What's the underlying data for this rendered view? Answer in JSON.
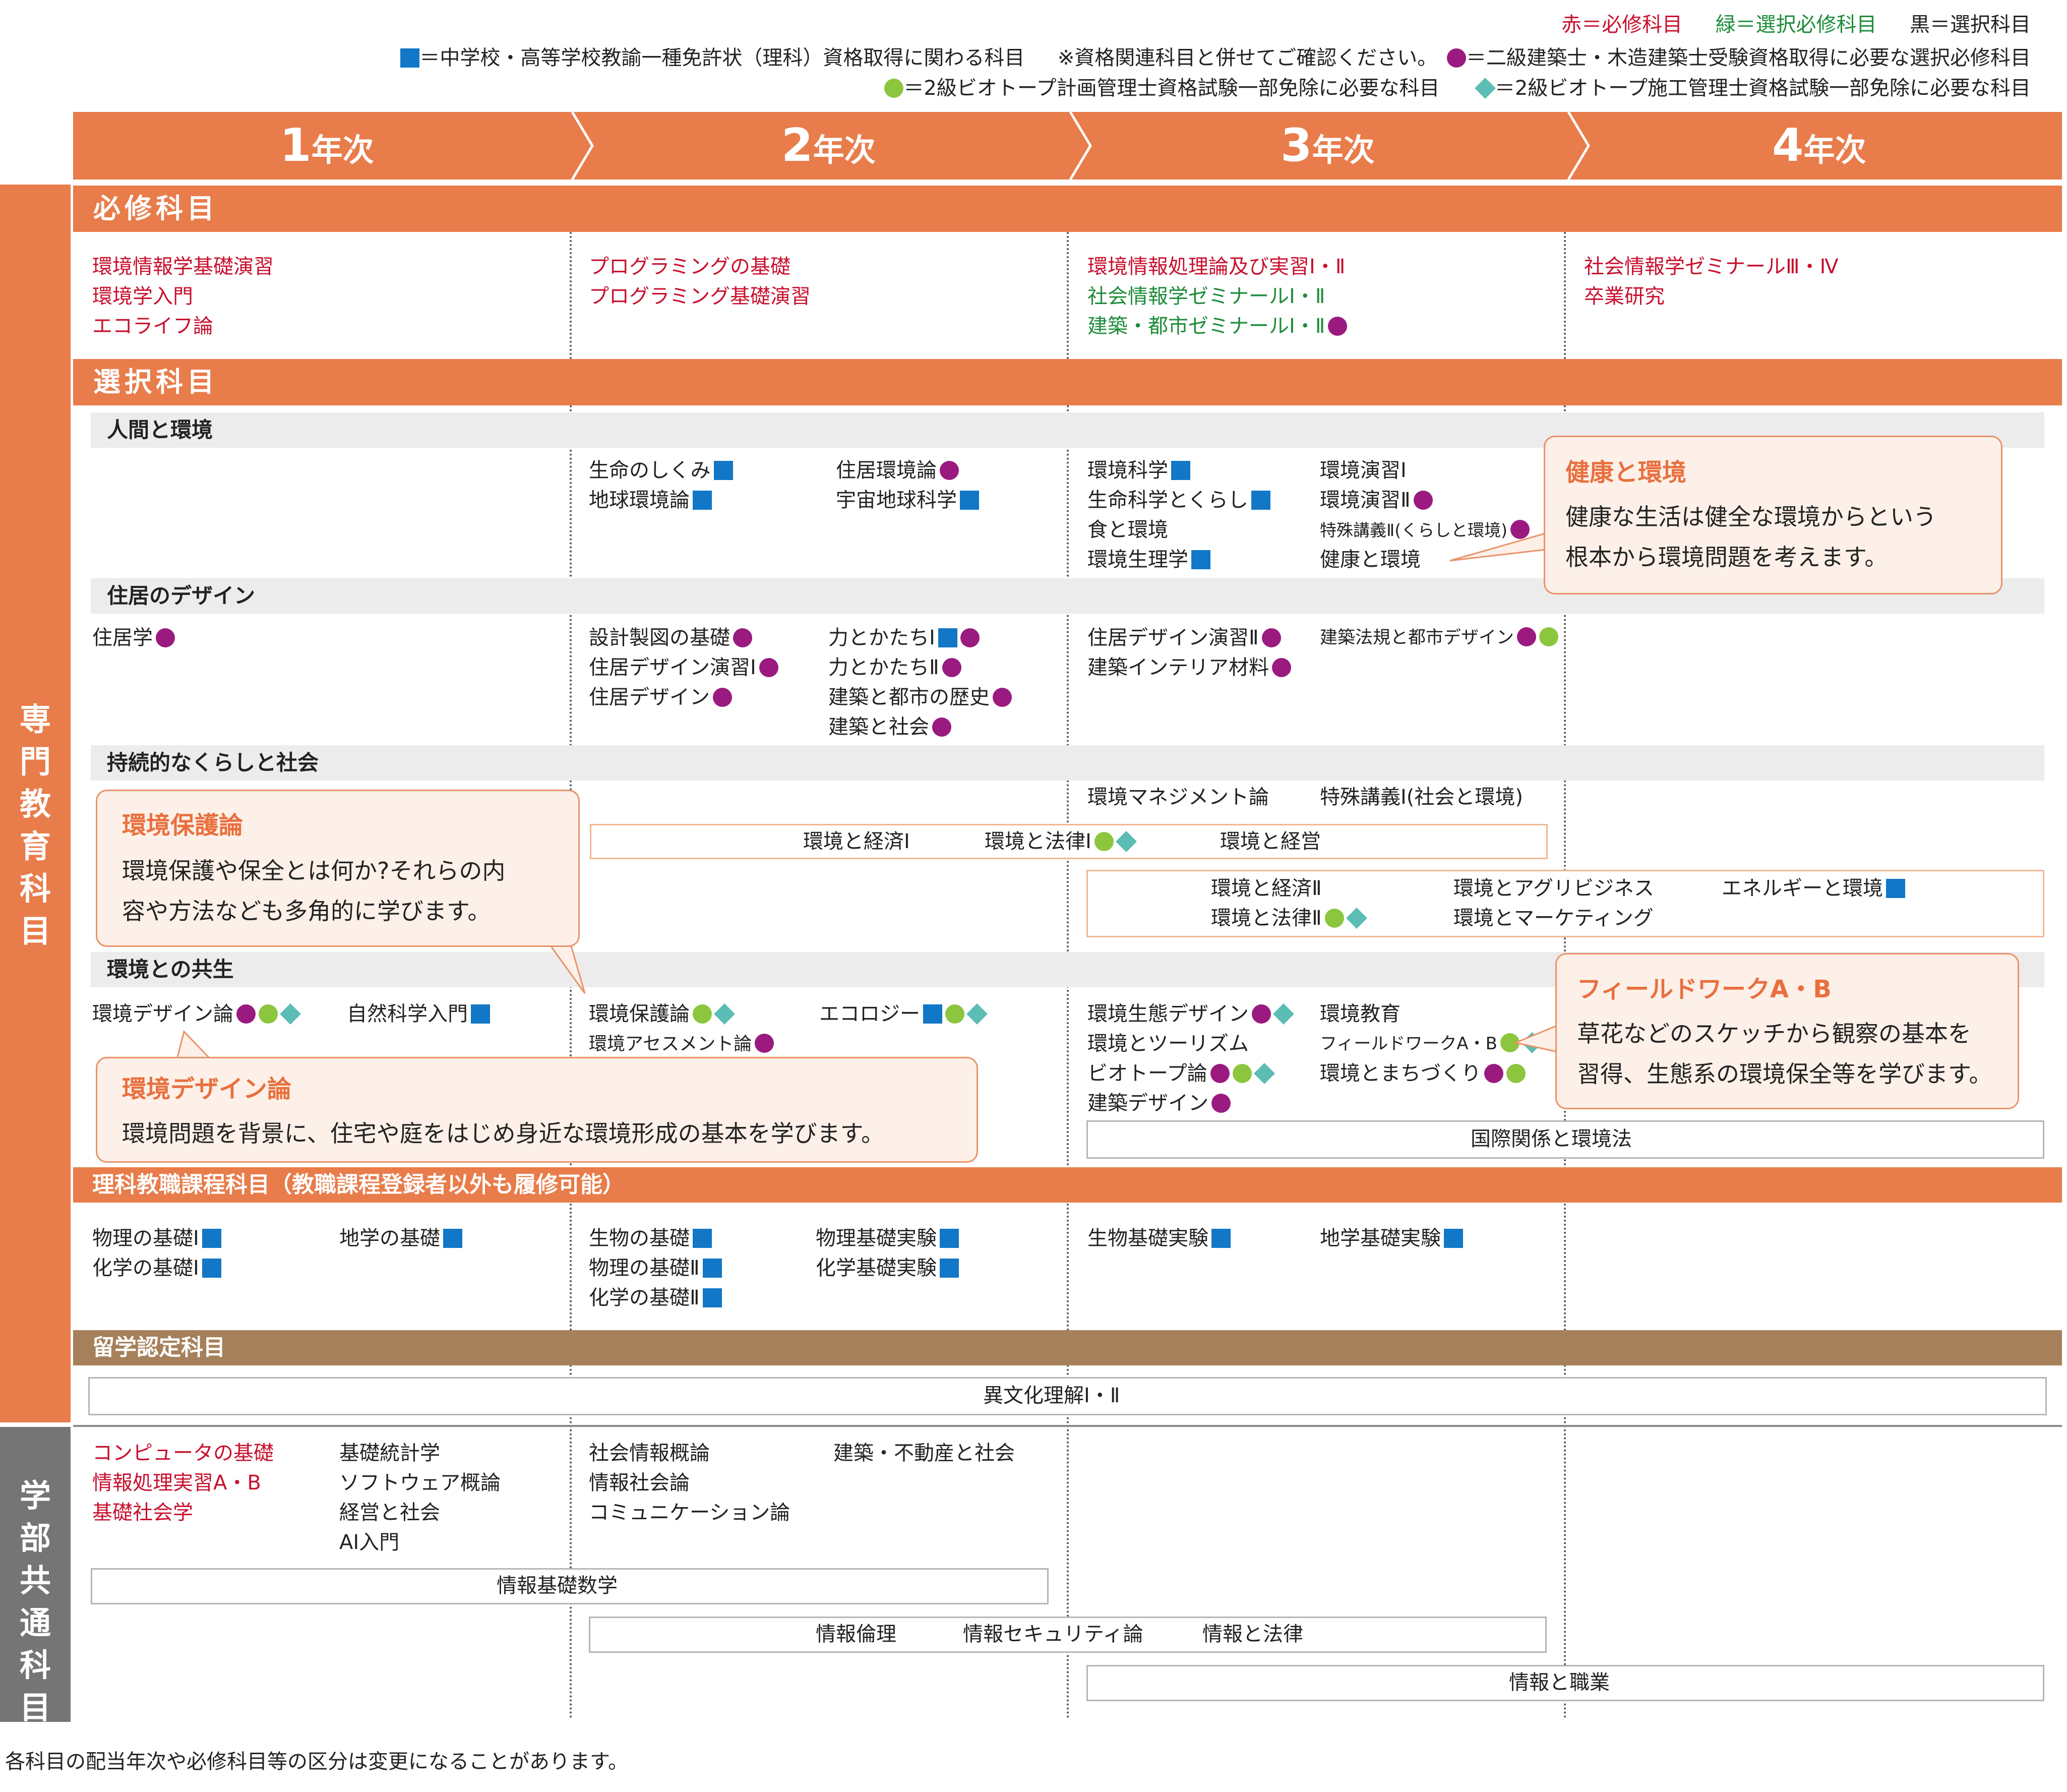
{
  "legend": {
    "line1": {
      "red": "赤＝必修科目",
      "green": "緑＝選択必修科目",
      "black": "黒＝選択科目"
    },
    "line2": {
      "teacher": "＝中学校・高等学校教諭一種免許状（理科）資格取得に関わる科目",
      "note": "※資格関連科目と併せてご確認ください。",
      "architect": "＝二級建築士・木造建築士受験資格取得に必要な選択必修科目"
    },
    "line3": {
      "biotope_plan": "＝2級ビオトープ計画管理士資格試験一部免除に必要な科目",
      "biotope_const": "＝2級ビオトープ施工管理士資格試験一部免除に必要な科目"
    },
    "colors": {
      "square": "#1177c6",
      "purple": "#9a1a80",
      "green": "#8cc63f",
      "diamond": "#5bbdb3",
      "orange": "#e87c4a",
      "brown": "#a5805a",
      "gray": "#757575"
    }
  },
  "years": [
    {
      "num": "1",
      "suffix": "年次"
    },
    {
      "num": "2",
      "suffix": "年次"
    },
    {
      "num": "3",
      "suffix": "年次"
    },
    {
      "num": "4",
      "suffix": "年次"
    }
  ],
  "sidebar": {
    "major": "専門教育科目",
    "common": "学部共通科目"
  },
  "sections": {
    "required": "必修科目",
    "elective": "選択科目",
    "human_env": "人間と環境",
    "housing": "住居のデザイン",
    "sustainable": "持続的なくらしと社会",
    "coexist": "環境との共生",
    "teacher": "理科教職課程科目（教職課程登録者以外も履修可能）",
    "abroad": "留学認定科目"
  },
  "required": {
    "y1": [
      "環境情報学基礎演習",
      "環境学入門",
      "エコライフ論"
    ],
    "y2": [
      "プログラミングの基礎",
      "プログラミング基礎演習"
    ],
    "y3": [
      "環境情報処理論及び実習Ⅰ・Ⅱ",
      "社会情報学ゼミナールⅠ・Ⅱ",
      "建築・都市ゼミナールⅠ・Ⅱ"
    ],
    "y4": [
      "社会情報学ゼミナールⅢ・Ⅳ",
      "卒業研究"
    ]
  },
  "human_env": {
    "y2a": [
      "生命のしくみ",
      "地球環境論"
    ],
    "y2b": [
      "住居環境論",
      "宇宙地球科学"
    ],
    "y3a": [
      "環境科学",
      "生命科学とくらし",
      "食と環境",
      "環境生理学"
    ],
    "y3b": [
      "環境演習Ⅰ",
      "環境演習Ⅱ",
      "特殊講義Ⅱ(くらしと環境)",
      "健康と環境"
    ]
  },
  "housing": {
    "y1": [
      "住居学"
    ],
    "y2a": [
      "設計製図の基礎",
      "住居デザイン演習Ⅰ",
      "住居デザイン"
    ],
    "y2b": [
      "力とかたちⅠ",
      "力とかたちⅡ",
      "建築と都市の歴史",
      "建築と社会"
    ],
    "y3a": [
      "住居デザイン演習Ⅱ",
      "建築インテリア材料"
    ],
    "y3b": [
      "建築法規と都市デザイン"
    ]
  },
  "sustainable": {
    "y3a": "環境マネジメント論",
    "y3b": "特殊講義Ⅰ(社会と環境)",
    "box1": [
      "環境と経済Ⅰ",
      "環境と法律Ⅰ",
      "環境と経営"
    ],
    "box2": [
      "環境と経済Ⅱ",
      "環境と法律Ⅱ",
      "環境とアグリビジネス",
      "環境とマーケティング",
      "エネルギーと環境"
    ]
  },
  "coexist": {
    "y1a": "環境デザイン論",
    "y1b": "自然科学入門",
    "y2a": [
      "環境保護論",
      "環境アセスメント論"
    ],
    "y2b": "エコロジー",
    "y3a": [
      "環境生態デザイン",
      "環境とツーリズム",
      "ビオトープ論",
      "建築デザイン"
    ],
    "y3b": [
      "環境教育",
      "フィールドワークA・B",
      "環境とまちづくり"
    ],
    "box": "国際関係と環境法"
  },
  "teacher": {
    "y1a": [
      "物理の基礎Ⅰ",
      "化学の基礎Ⅰ"
    ],
    "y1b": [
      "地学の基礎"
    ],
    "y2a": [
      "生物の基礎",
      "物理の基礎Ⅱ",
      "化学の基礎Ⅱ"
    ],
    "y2b": [
      "物理基礎実験",
      "化学基礎実験"
    ],
    "y3a": [
      "生物基礎実験"
    ],
    "y3b": [
      "地学基礎実験"
    ]
  },
  "abroad": {
    "box": "異文化理解Ⅰ・Ⅱ"
  },
  "common": {
    "y1a": [
      "コンピュータの基礎",
      "情報処理実習A・B",
      "基礎社会学"
    ],
    "y1b": [
      "基礎統計学",
      "ソフトウェア概論",
      "経営と社会",
      "AI入門"
    ],
    "y2a": [
      "社会情報概論",
      "情報社会論",
      "コミュニケーション論"
    ],
    "y2b": [
      "建築・不動産と社会"
    ],
    "box1": "情報基礎数学",
    "box2": [
      "情報倫理",
      "情報セキュリティ論",
      "情報と法律"
    ],
    "box3": "情報と職業"
  },
  "callouts": {
    "health": {
      "title": "健康と環境",
      "lines": [
        "健康な生活は健全な環境からという",
        "根本から環境問題を考えます。"
      ]
    },
    "protect": {
      "title": "環境保護論",
      "lines": [
        "環境保護や保全とは何か?それらの内",
        "容や方法なども多角的に学びます。"
      ]
    },
    "field": {
      "title": "フィールドワークA・B",
      "lines": [
        "草花などのスケッチから観察の基本を",
        "習得、生態系の環境保全等を学びます。"
      ]
    },
    "design": {
      "title": "環境デザイン論",
      "lines": [
        "環境問題を背景に、住宅や庭をはじめ身近な環境形成の基本を学びます。"
      ]
    }
  },
  "footnote": "各科目の配当年次や必修科目等の区分は変更になることがあります。"
}
